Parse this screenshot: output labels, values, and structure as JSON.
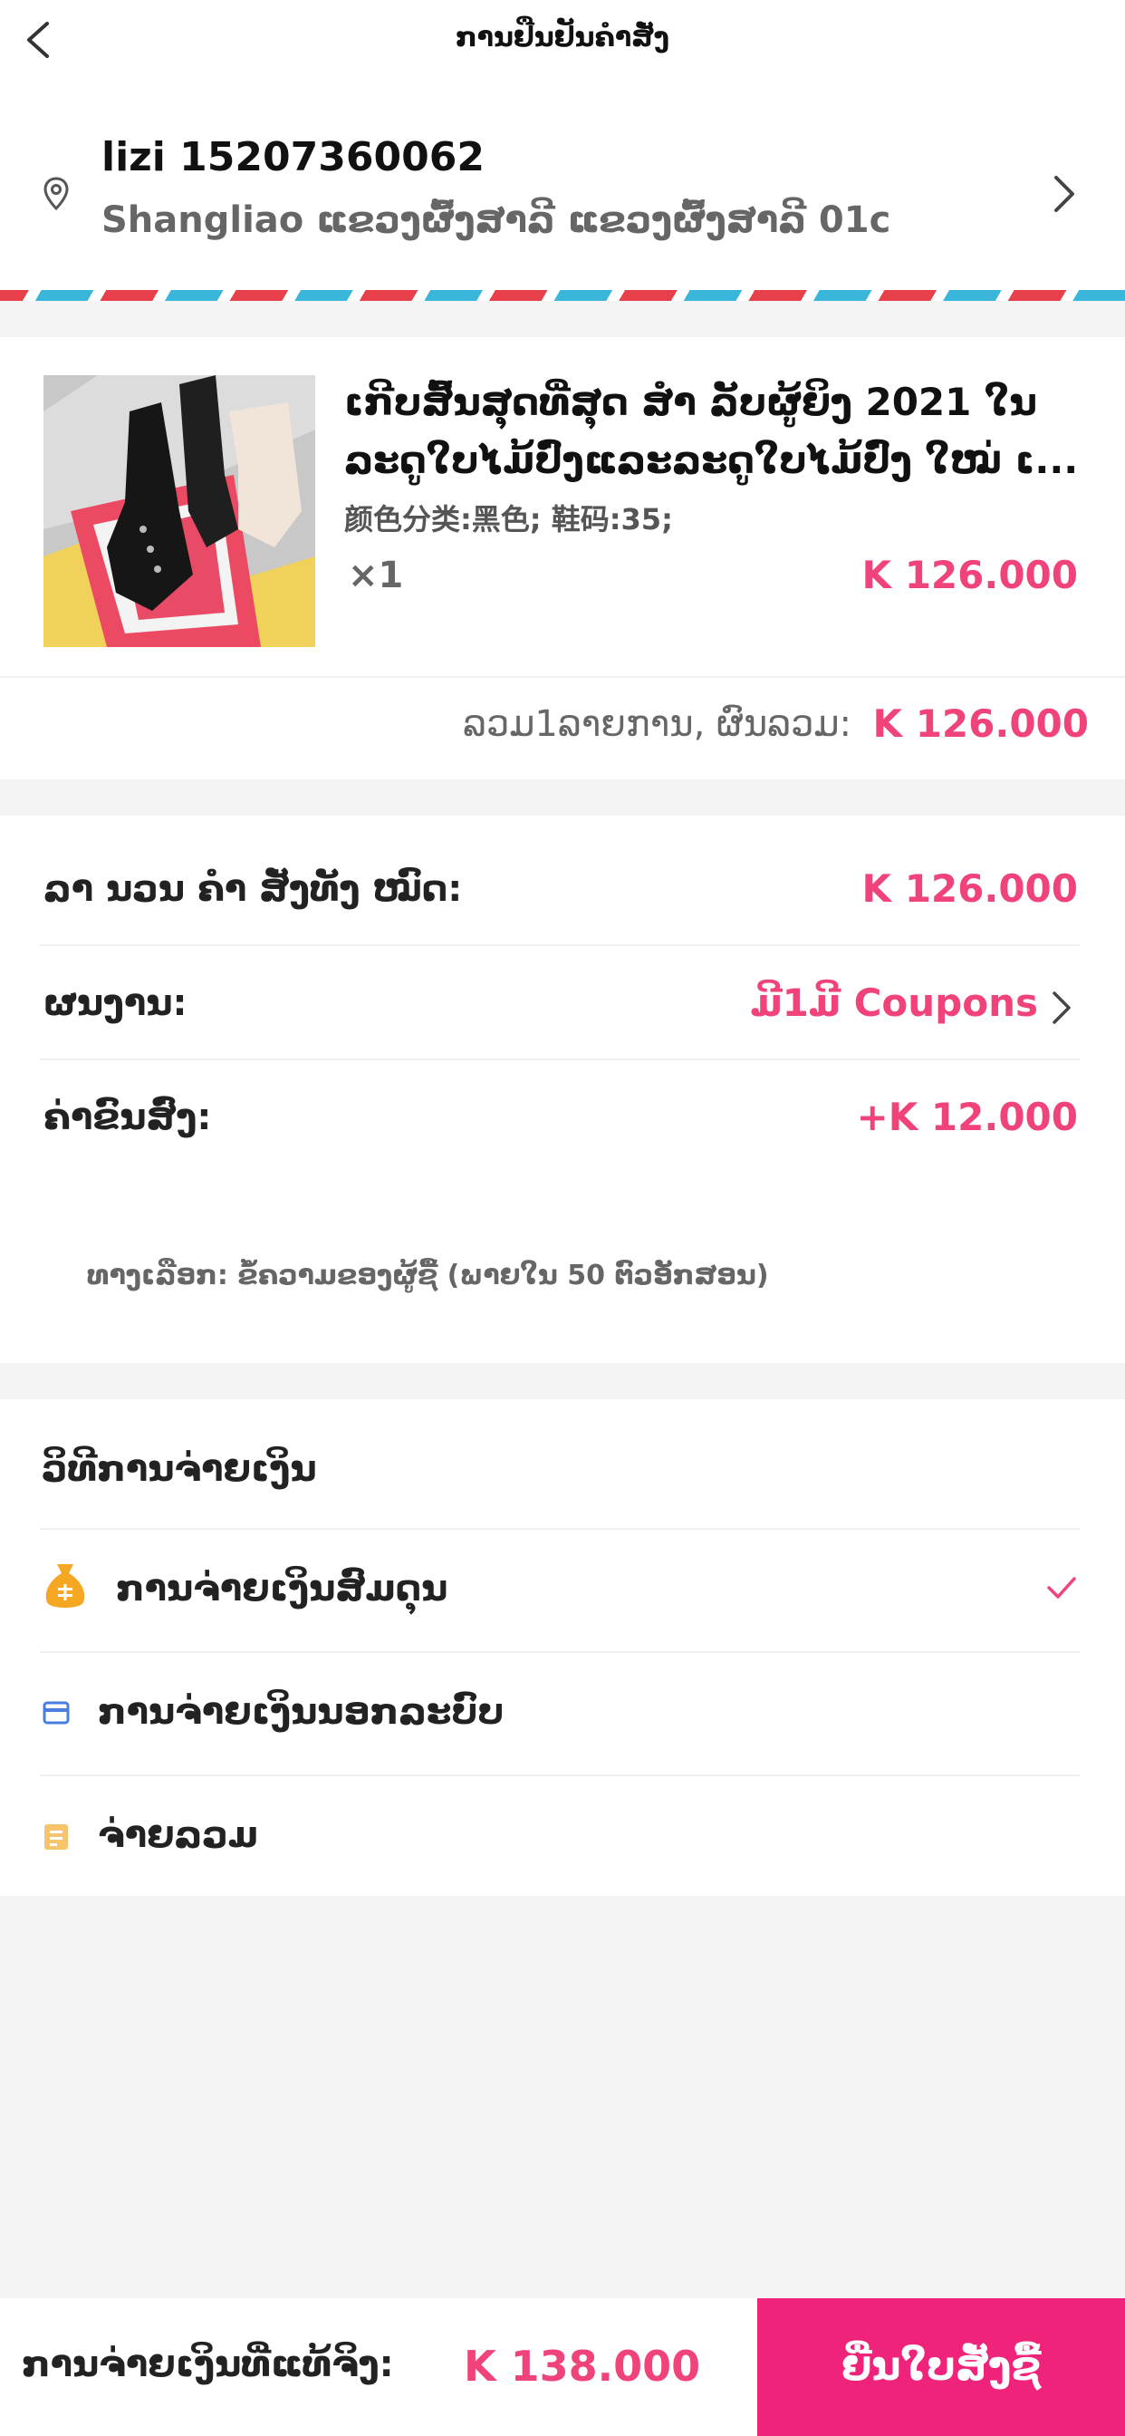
{
  "header": {
    "title": "ການຢືນຢັນຄໍາສັ່ງ"
  },
  "address": {
    "name_phone": "lizi 15207360062",
    "line": "Shangliao ແຂວງຜົ້ງສາລີ ແຂວງຜົ້ງສາລີ 01c"
  },
  "product": {
    "title": "ເກີບສົ້ນສຸດທີ່ສຸດ ສໍາ ລັບຜູ້ຍິງ 2021 ໃນ ລະດູໃບໄມ້ປົ່ງແລະລະດູໃບໄມ້ປົ່ງ ໃໝ່ ເ...",
    "spec": "颜色分类:黑色; 鞋码:35;",
    "qty": "×1",
    "price": "K 126.000"
  },
  "summary": {
    "label": "ລວມ1ລາຍການ,  ຜົນລວມ:",
    "total": "K 126.000"
  },
  "fees": {
    "goods_label": "ລາ ນວນ ຄໍາ ສັ່ງທັງ ໝົດ:",
    "goods_value": "K 126.000",
    "coupon_label": "ຜນງານ:",
    "coupon_value": "ມີ1ມີ Coupons",
    "shipping_label": "ຄ່າຂົນສົ່ງ:",
    "shipping_value": "+K 12.000",
    "note": "ທາງເລືອກ: ຂໍ້ຄວາມຂອງຜູ້ຊື້ (ພາຍໃນ 50 ຕົວອັກສອນ)"
  },
  "payment": {
    "title": "ວິທີການຈ່າຍເງິນ",
    "options": [
      {
        "label": "ການຈ່າຍເງິນສົມດຸນ",
        "icon": "money-bag-icon",
        "selected": true
      },
      {
        "label": "ການຈ່າຍເງິນນອກລະບົບ",
        "icon": "card-icon",
        "selected": false
      },
      {
        "label": "ຈ່າຍລວມ",
        "icon": "receipt-icon",
        "selected": false
      }
    ]
  },
  "bottom": {
    "total_label": "ການຈ່າຍເງິນທີ່ແທ້ຈິງ:",
    "total_value": "K 138.000",
    "submit_label": "ຍື່ນໃບສັ່ງຊື້"
  },
  "colors": {
    "accent": "#f0437a",
    "submit": "#f0237a",
    "background": "#f4f4f4"
  }
}
